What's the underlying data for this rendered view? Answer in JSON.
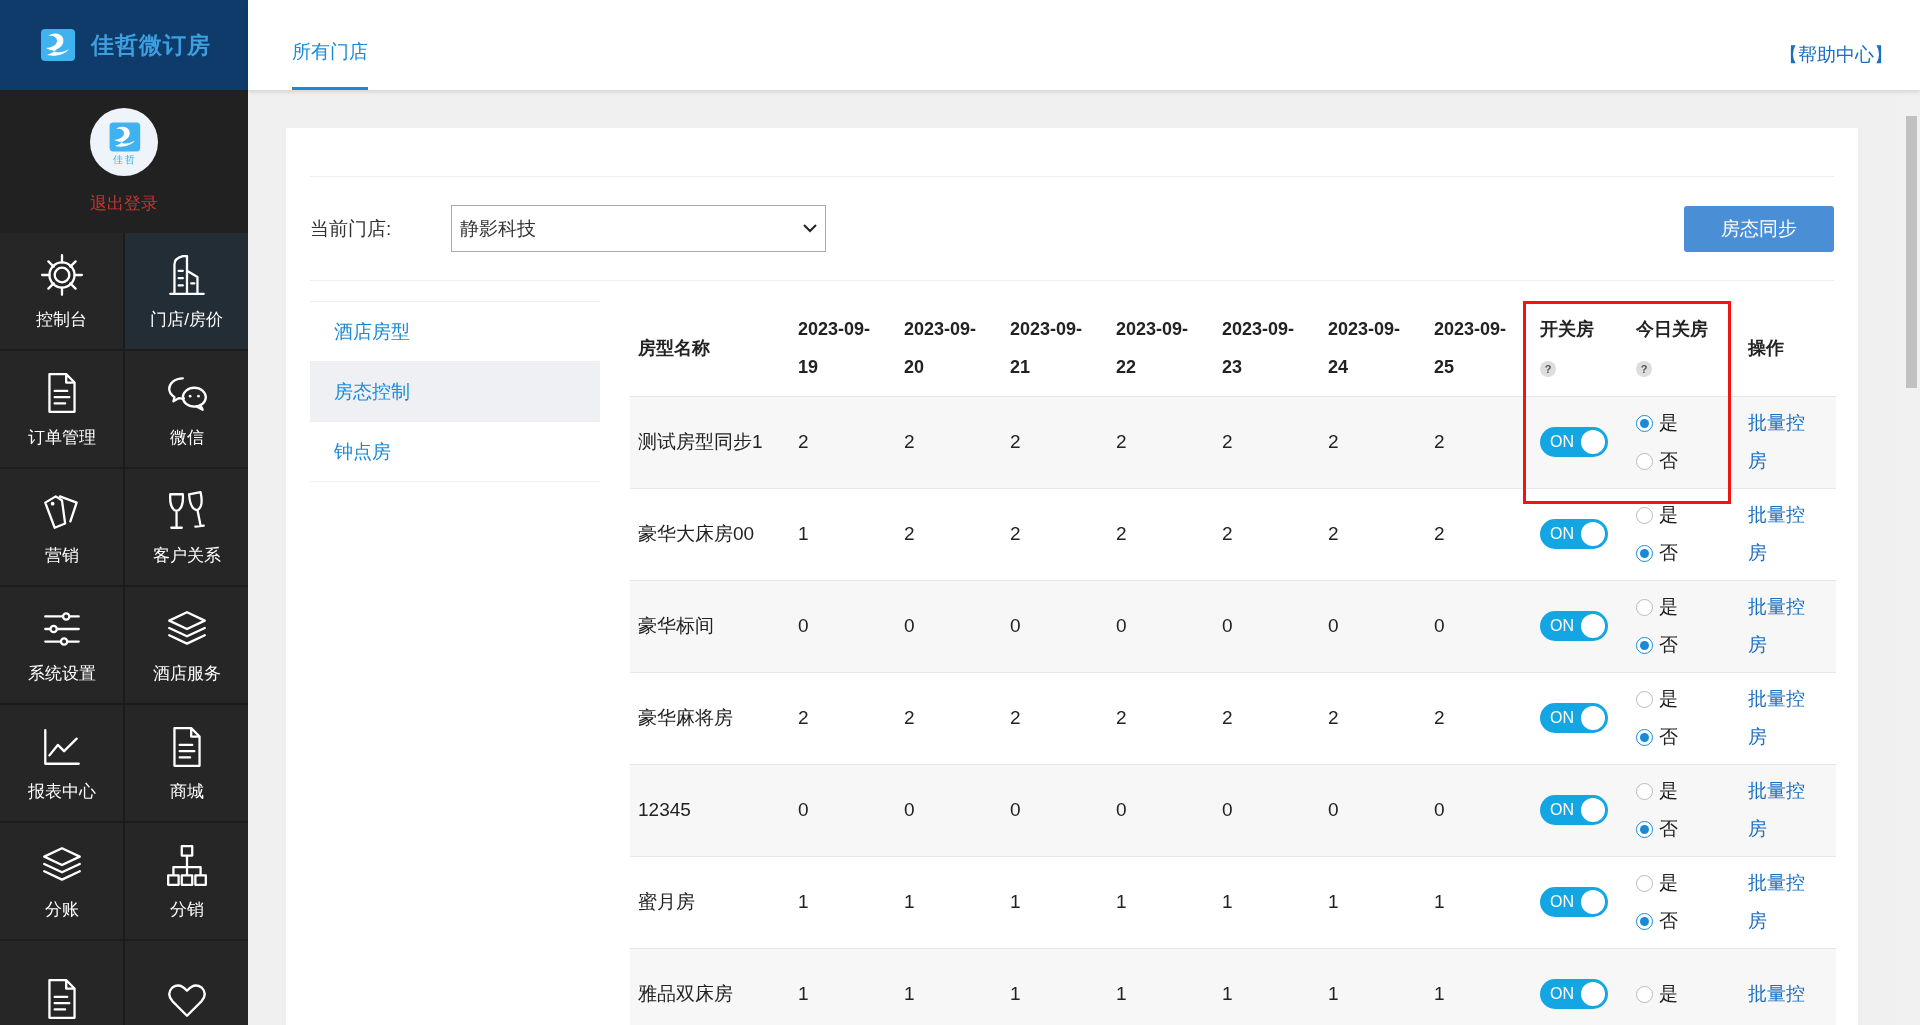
{
  "brand": {
    "name": "佳哲微订房",
    "avatar_caption": "佳 哲",
    "logout": "退出登录"
  },
  "sidebar": {
    "items": [
      {
        "label": "控制台",
        "selected": false
      },
      {
        "label": "门店/房价",
        "selected": true
      },
      {
        "label": "订单管理",
        "selected": false
      },
      {
        "label": "微信",
        "selected": false
      },
      {
        "label": "营销",
        "selected": false
      },
      {
        "label": "客户关系",
        "selected": false
      },
      {
        "label": "系统设置",
        "selected": false
      },
      {
        "label": "酒店服务",
        "selected": false
      },
      {
        "label": "报表中心",
        "selected": false
      },
      {
        "label": "商城",
        "selected": false
      },
      {
        "label": "分账",
        "selected": false
      },
      {
        "label": "分销",
        "selected": false
      },
      {
        "selected": false
      },
      {
        "selected": false
      }
    ]
  },
  "tabs": [
    {
      "label": "所有门店",
      "selected": true
    }
  ],
  "help_link": "【帮助中心】",
  "filter": {
    "label": "当前门店:",
    "value": "静影科技"
  },
  "sync_button": "房态同步",
  "subnav": [
    {
      "label": "酒店房型",
      "selected": false
    },
    {
      "label": "房态控制",
      "selected": true
    },
    {
      "label": "钟点房",
      "selected": false
    }
  ],
  "table": {
    "columns": [
      {
        "label": "房型名称"
      },
      {
        "label": "2023-09-19"
      },
      {
        "label": "2023-09-20"
      },
      {
        "label": "2023-09-21"
      },
      {
        "label": "2023-09-22"
      },
      {
        "label": "2023-09-23"
      },
      {
        "label": "2023-09-24"
      },
      {
        "label": "2023-09-25"
      },
      {
        "label": "开关房",
        "hint": "?"
      },
      {
        "label": "今日关房",
        "hint": "?"
      },
      {
        "label": "操作"
      }
    ],
    "annotation": {
      "kind": "highlight-box"
    },
    "rows": [
      {
        "name": "测试房型同步1",
        "counts": [
          "2",
          "2",
          "2",
          "2",
          "2",
          "2",
          "2"
        ],
        "switch": {
          "label": "ON",
          "on": true
        },
        "close_today": [
          {
            "label": "是",
            "selected": true
          },
          {
            "label": "否",
            "selected": false
          }
        ],
        "action": "批量控房"
      },
      {
        "name": "豪华大床房00",
        "counts": [
          "1",
          "2",
          "2",
          "2",
          "2",
          "2",
          "2"
        ],
        "switch": {
          "label": "ON",
          "on": true
        },
        "close_today": [
          {
            "label": "是",
            "selected": false
          },
          {
            "label": "否",
            "selected": true
          }
        ],
        "action": "批量控房"
      },
      {
        "name": "豪华标间",
        "counts": [
          "0",
          "0",
          "0",
          "0",
          "0",
          "0",
          "0"
        ],
        "switch": {
          "label": "ON",
          "on": true
        },
        "close_today": [
          {
            "label": "是",
            "selected": false
          },
          {
            "label": "否",
            "selected": true
          }
        ],
        "action": "批量控房"
      },
      {
        "name": "豪华麻将房",
        "counts": [
          "2",
          "2",
          "2",
          "2",
          "2",
          "2",
          "2"
        ],
        "switch": {
          "label": "ON",
          "on": true
        },
        "close_today": [
          {
            "label": "是",
            "selected": false
          },
          {
            "label": "否",
            "selected": true
          }
        ],
        "action": "批量控房"
      },
      {
        "name": "12345",
        "counts": [
          "0",
          "0",
          "0",
          "0",
          "0",
          "0",
          "0"
        ],
        "switch": {
          "label": "ON",
          "on": true
        },
        "close_today": [
          {
            "label": "是",
            "selected": false
          },
          {
            "label": "否",
            "selected": true
          }
        ],
        "action": "批量控房"
      },
      {
        "name": "蜜月房",
        "counts": [
          "1",
          "1",
          "1",
          "1",
          "1",
          "1",
          "1"
        ],
        "switch": {
          "label": "ON",
          "on": true
        },
        "close_today": [
          {
            "label": "是",
            "selected": false
          },
          {
            "label": "否",
            "selected": true
          }
        ],
        "action": "批量控房"
      },
      {
        "name": "雅品双床房",
        "counts": [
          "1",
          "1",
          "1",
          "1",
          "1",
          "1",
          "1"
        ],
        "switch": {
          "label": "ON",
          "on": true
        },
        "close_today": [
          {
            "label": "是",
            "selected": false
          }
        ],
        "action": "批量控"
      }
    ]
  }
}
